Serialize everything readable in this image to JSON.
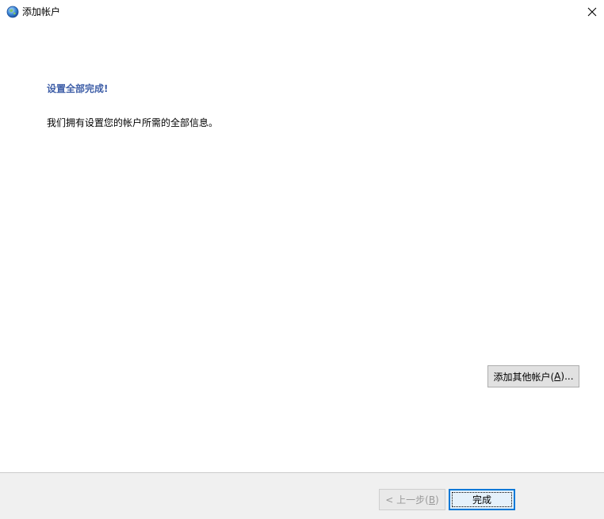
{
  "window": {
    "title": "添加帐户",
    "close_glyph": "×"
  },
  "content": {
    "heading": "设置全部完成!",
    "message": "我们拥有设置您的帐户所需的全部信息。"
  },
  "buttons": {
    "add_other": {
      "prefix": "添加其他帐户(",
      "access_key": "A",
      "suffix": ")..."
    },
    "back": {
      "prefix": "< 上一步(",
      "access_key": "B",
      "suffix": ")"
    },
    "finish": {
      "label": "完成"
    }
  },
  "icons": {
    "app": "outlook-account-globe-icon",
    "close": "close-icon"
  },
  "colors": {
    "heading": "#3f5fa8",
    "footer_bg": "#f0f0f0",
    "default_button_border": "#0078d7"
  }
}
